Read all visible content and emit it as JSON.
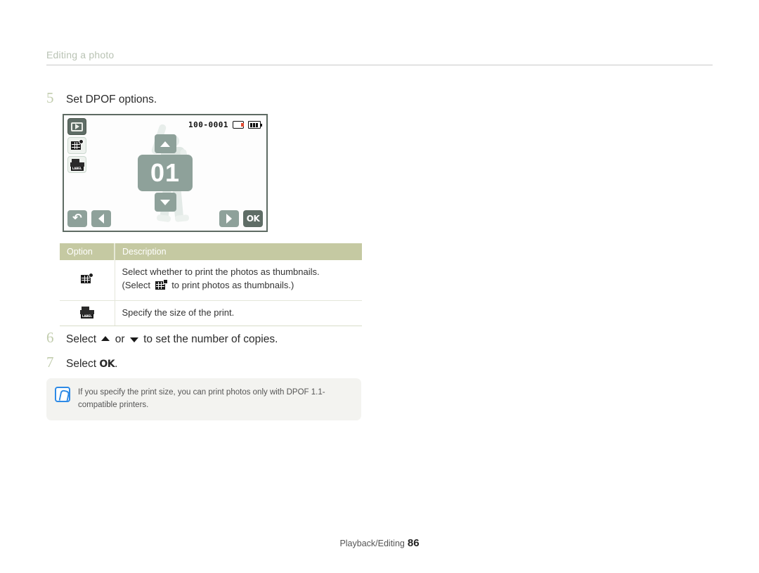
{
  "header": {
    "title": "Editing a photo"
  },
  "steps": [
    {
      "num": "5",
      "text": "Set DPOF options."
    },
    {
      "num": "6",
      "text_before": "Select ",
      "text_mid": " or ",
      "text_after": " to set the number of copies.",
      "icon_up": "chevron-up-glyph",
      "icon_down": "chevron-down-glyph"
    },
    {
      "num": "7",
      "text_before": "Select ",
      "ok_label": "OK",
      "text_after": "."
    }
  ],
  "lcd": {
    "file_number": "100-0001",
    "card_icon": "memory-card-icon",
    "battery_icon": "battery-full-icon",
    "left_icons": [
      {
        "name": "playback-mode-icon",
        "label": "Playback"
      },
      {
        "name": "index-print-icon",
        "label": "Index print"
      },
      {
        "name": "print-size-icon",
        "label": "LABEL"
      }
    ],
    "counter_value": "01",
    "up_button": "chevron-up-icon",
    "down_button": "chevron-down-icon",
    "bottom_left": [
      {
        "name": "back-icon",
        "glyph": "↶"
      },
      {
        "name": "previous-icon",
        "glyph": "◀"
      }
    ],
    "bottom_right": [
      {
        "name": "next-icon",
        "glyph": "▶"
      },
      {
        "name": "ok-button",
        "glyph": "OK"
      }
    ]
  },
  "table": {
    "headers": [
      "Option",
      "Description"
    ],
    "rows": [
      {
        "icon": "index-print-icon",
        "desc_line1": "Select whether to print the photos as thumbnails.",
        "desc_pre": "(Select ",
        "desc_inline_icon": "index-print-checked-icon",
        "desc_post": " to print photos as thumbnails.)"
      },
      {
        "icon": "print-size-icon",
        "desc_line1": "Specify the size of the print.",
        "desc_pre": "",
        "desc_inline_icon": "",
        "desc_post": ""
      }
    ]
  },
  "note": {
    "icon": "note-pen-icon",
    "text": "If you specify the print size, you can print photos only with DPOF 1.1-compatible printers."
  },
  "footer": {
    "section": "Playback/Editing",
    "page": "86"
  },
  "colors": {
    "header_text": "#b9c3b4",
    "step_number": "#c2cdae",
    "table_header_bg": "#c5c9a2",
    "note_bg": "#f3f3f0",
    "note_icon": "#2e8ae6",
    "lcd_border": "#5e6b63",
    "lcd_button": "#8ea19a"
  }
}
